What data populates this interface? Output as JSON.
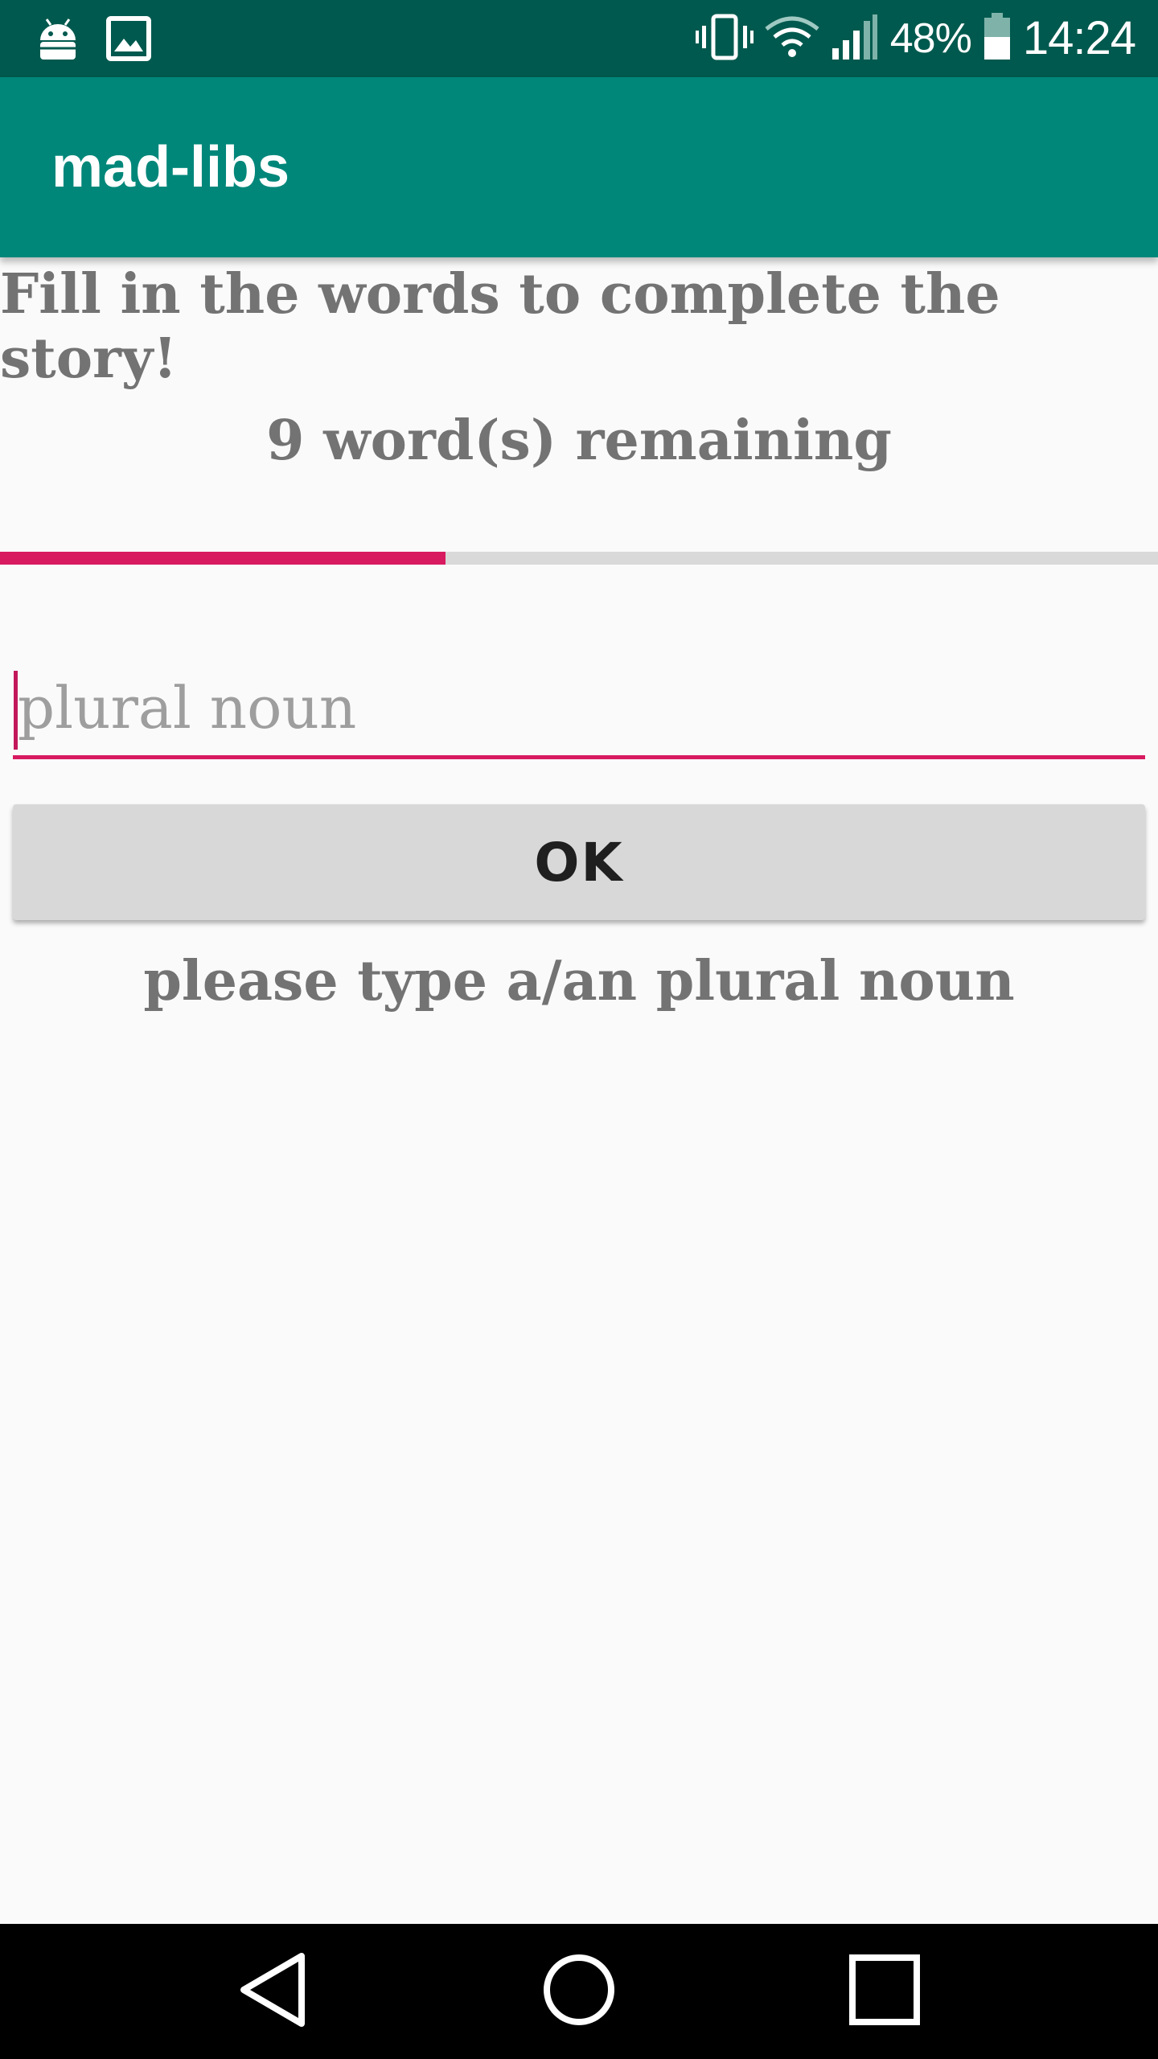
{
  "status_bar": {
    "left_icons": [
      "android-debug-icon",
      "image-icon"
    ],
    "right_icons": [
      "vibrate-icon",
      "wifi-icon",
      "signal-icon",
      "battery-icon"
    ],
    "battery": "48%",
    "time": "14:24"
  },
  "app_bar": {
    "title": "mad-libs"
  },
  "main": {
    "instructions": "Fill in the words to complete the story!",
    "remaining": "9 word(s) remaining",
    "progress": 0.385,
    "input_placeholder": "plural noun",
    "input_value": "",
    "ok_label": "OK",
    "hint": "please type a/an plural noun"
  },
  "nav_bar": {
    "buttons": [
      "back-icon",
      "home-icon",
      "recents-icon"
    ]
  },
  "colors": {
    "status_bar": "#00594e",
    "app_bar": "#00877a",
    "accent": "#d81b60",
    "text_gray": "#737373",
    "button_bg": "#d8d8d8"
  }
}
